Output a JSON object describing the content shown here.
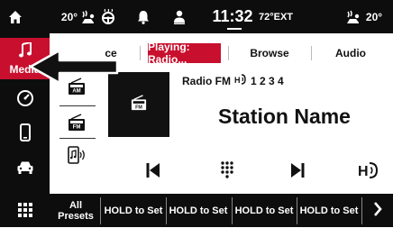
{
  "status_bar": {
    "driver_temp": "20°",
    "passenger_temp": "20°",
    "clock": "11:32",
    "ext_temp": "72°EXT"
  },
  "sidebar": {
    "items": [
      {
        "name": "media",
        "label": "Media",
        "icon": "music-note-icon",
        "active": true
      },
      {
        "name": "controls",
        "icon": "gauge-icon"
      },
      {
        "name": "phone",
        "icon": "phone-icon"
      },
      {
        "name": "vehicle",
        "icon": "car-icon"
      },
      {
        "name": "apps",
        "icon": "grid-icon"
      }
    ]
  },
  "tabs": {
    "source": "ce",
    "playing": "Playing: Radio...",
    "browse": "Browse",
    "audio": "Audio"
  },
  "sources": {
    "am": "AM",
    "fm": "FM"
  },
  "station": {
    "band": "Radio FM",
    "hd_channels": "1 2 3 4",
    "name": "Station Name",
    "art_label": "FM"
  },
  "presets": {
    "all_label": "All Presets",
    "all_line1": "All",
    "all_line2": "Presets",
    "slots": [
      "HOLD to Set",
      "HOLD to Set",
      "HOLD to Set",
      "HOLD to Set"
    ]
  },
  "colors": {
    "accent": "#c8102e",
    "bar": "#0d0d0d"
  }
}
